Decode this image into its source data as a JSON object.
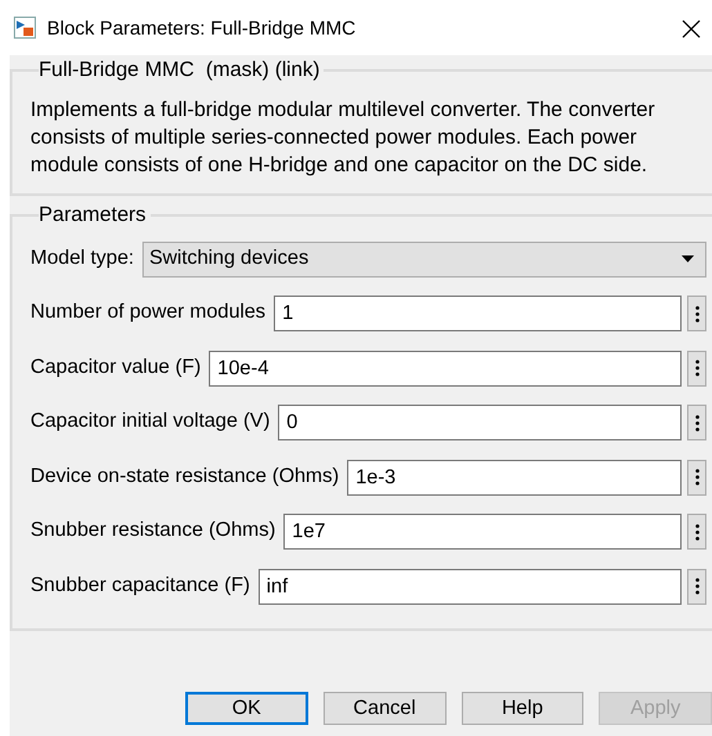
{
  "window": {
    "title": "Block Parameters: Full-Bridge MMC"
  },
  "mask_group": {
    "title": "Full-Bridge MMC  (mask) (link)",
    "description": "Implements a full-bridge modular multilevel converter. The converter consists of multiple series-connected power modules. Each power module consists of one H-bridge and one capacitor on the DC side."
  },
  "parameters": {
    "title": "Parameters",
    "model_type": {
      "label": "Model type:",
      "value": "Switching devices"
    },
    "fields": [
      {
        "label": "Number of power modules",
        "value": "1"
      },
      {
        "label": "Capacitor value (F)",
        "value": "10e-4"
      },
      {
        "label": "Capacitor initial voltage (V)",
        "value": "0"
      },
      {
        "label": "Device on-state resistance (Ohms)",
        "value": "1e-3"
      },
      {
        "label": "Snubber resistance (Ohms)",
        "value": "1e7"
      },
      {
        "label": "Snubber capacitance (F)",
        "value": "inf"
      }
    ]
  },
  "buttons": [
    {
      "label": "OK",
      "default": true,
      "disabled": false
    },
    {
      "label": "Cancel",
      "default": false,
      "disabled": false
    },
    {
      "label": "Help",
      "default": false,
      "disabled": false
    },
    {
      "label": "Apply",
      "default": false,
      "disabled": true
    }
  ]
}
